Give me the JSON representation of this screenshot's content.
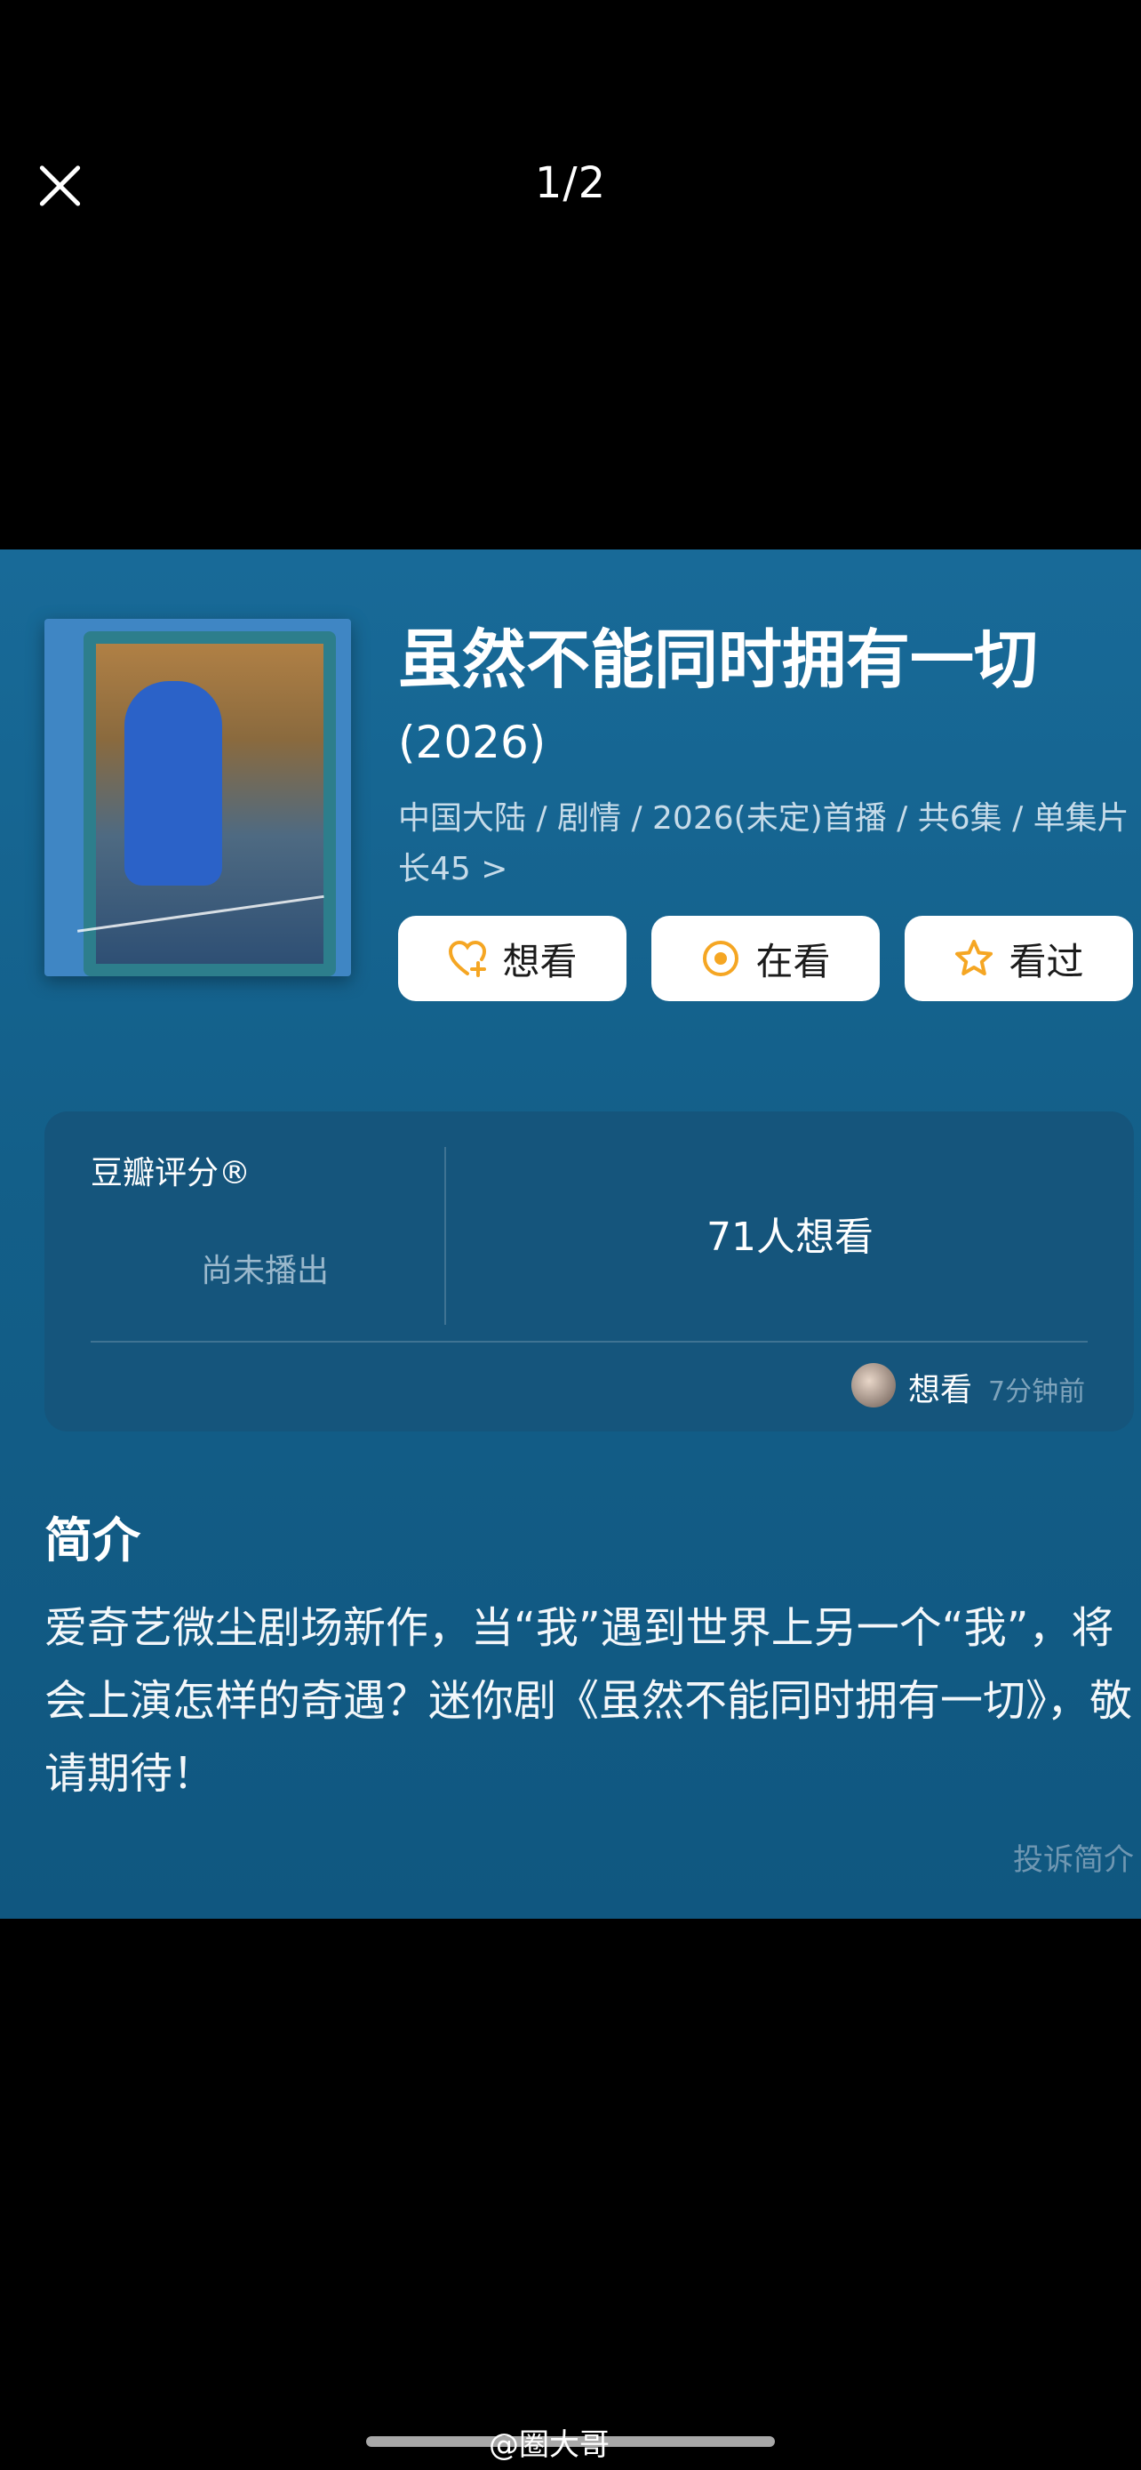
{
  "viewer": {
    "pager": "1/2",
    "close_icon": "close-icon"
  },
  "movie": {
    "title": "虽然不能同时拥有一切",
    "year": "(2026)",
    "meta": "中国大陆 / 剧情 / 2026(未定)首播 / 共6集 / 单集片长45 >"
  },
  "actions": {
    "want": "想看",
    "watching": "在看",
    "watched": "看过"
  },
  "rating": {
    "label": "豆瓣评分®",
    "status": "尚未播出",
    "want_count": "71人想看",
    "recent_action": "想看",
    "recent_time": "7分钟前"
  },
  "intro": {
    "heading": "简介",
    "text": "爱奇艺微尘剧场新作，当“我”遇到世界上另一个“我”，将会上演怎样的奇遇？迷你剧《虽然不能同时拥有一切》，敬请期待！",
    "report": "投诉简介"
  },
  "watermark": "@圈大哥",
  "colors": {
    "card_bg": "#135f89",
    "accent": "#f5a623"
  }
}
